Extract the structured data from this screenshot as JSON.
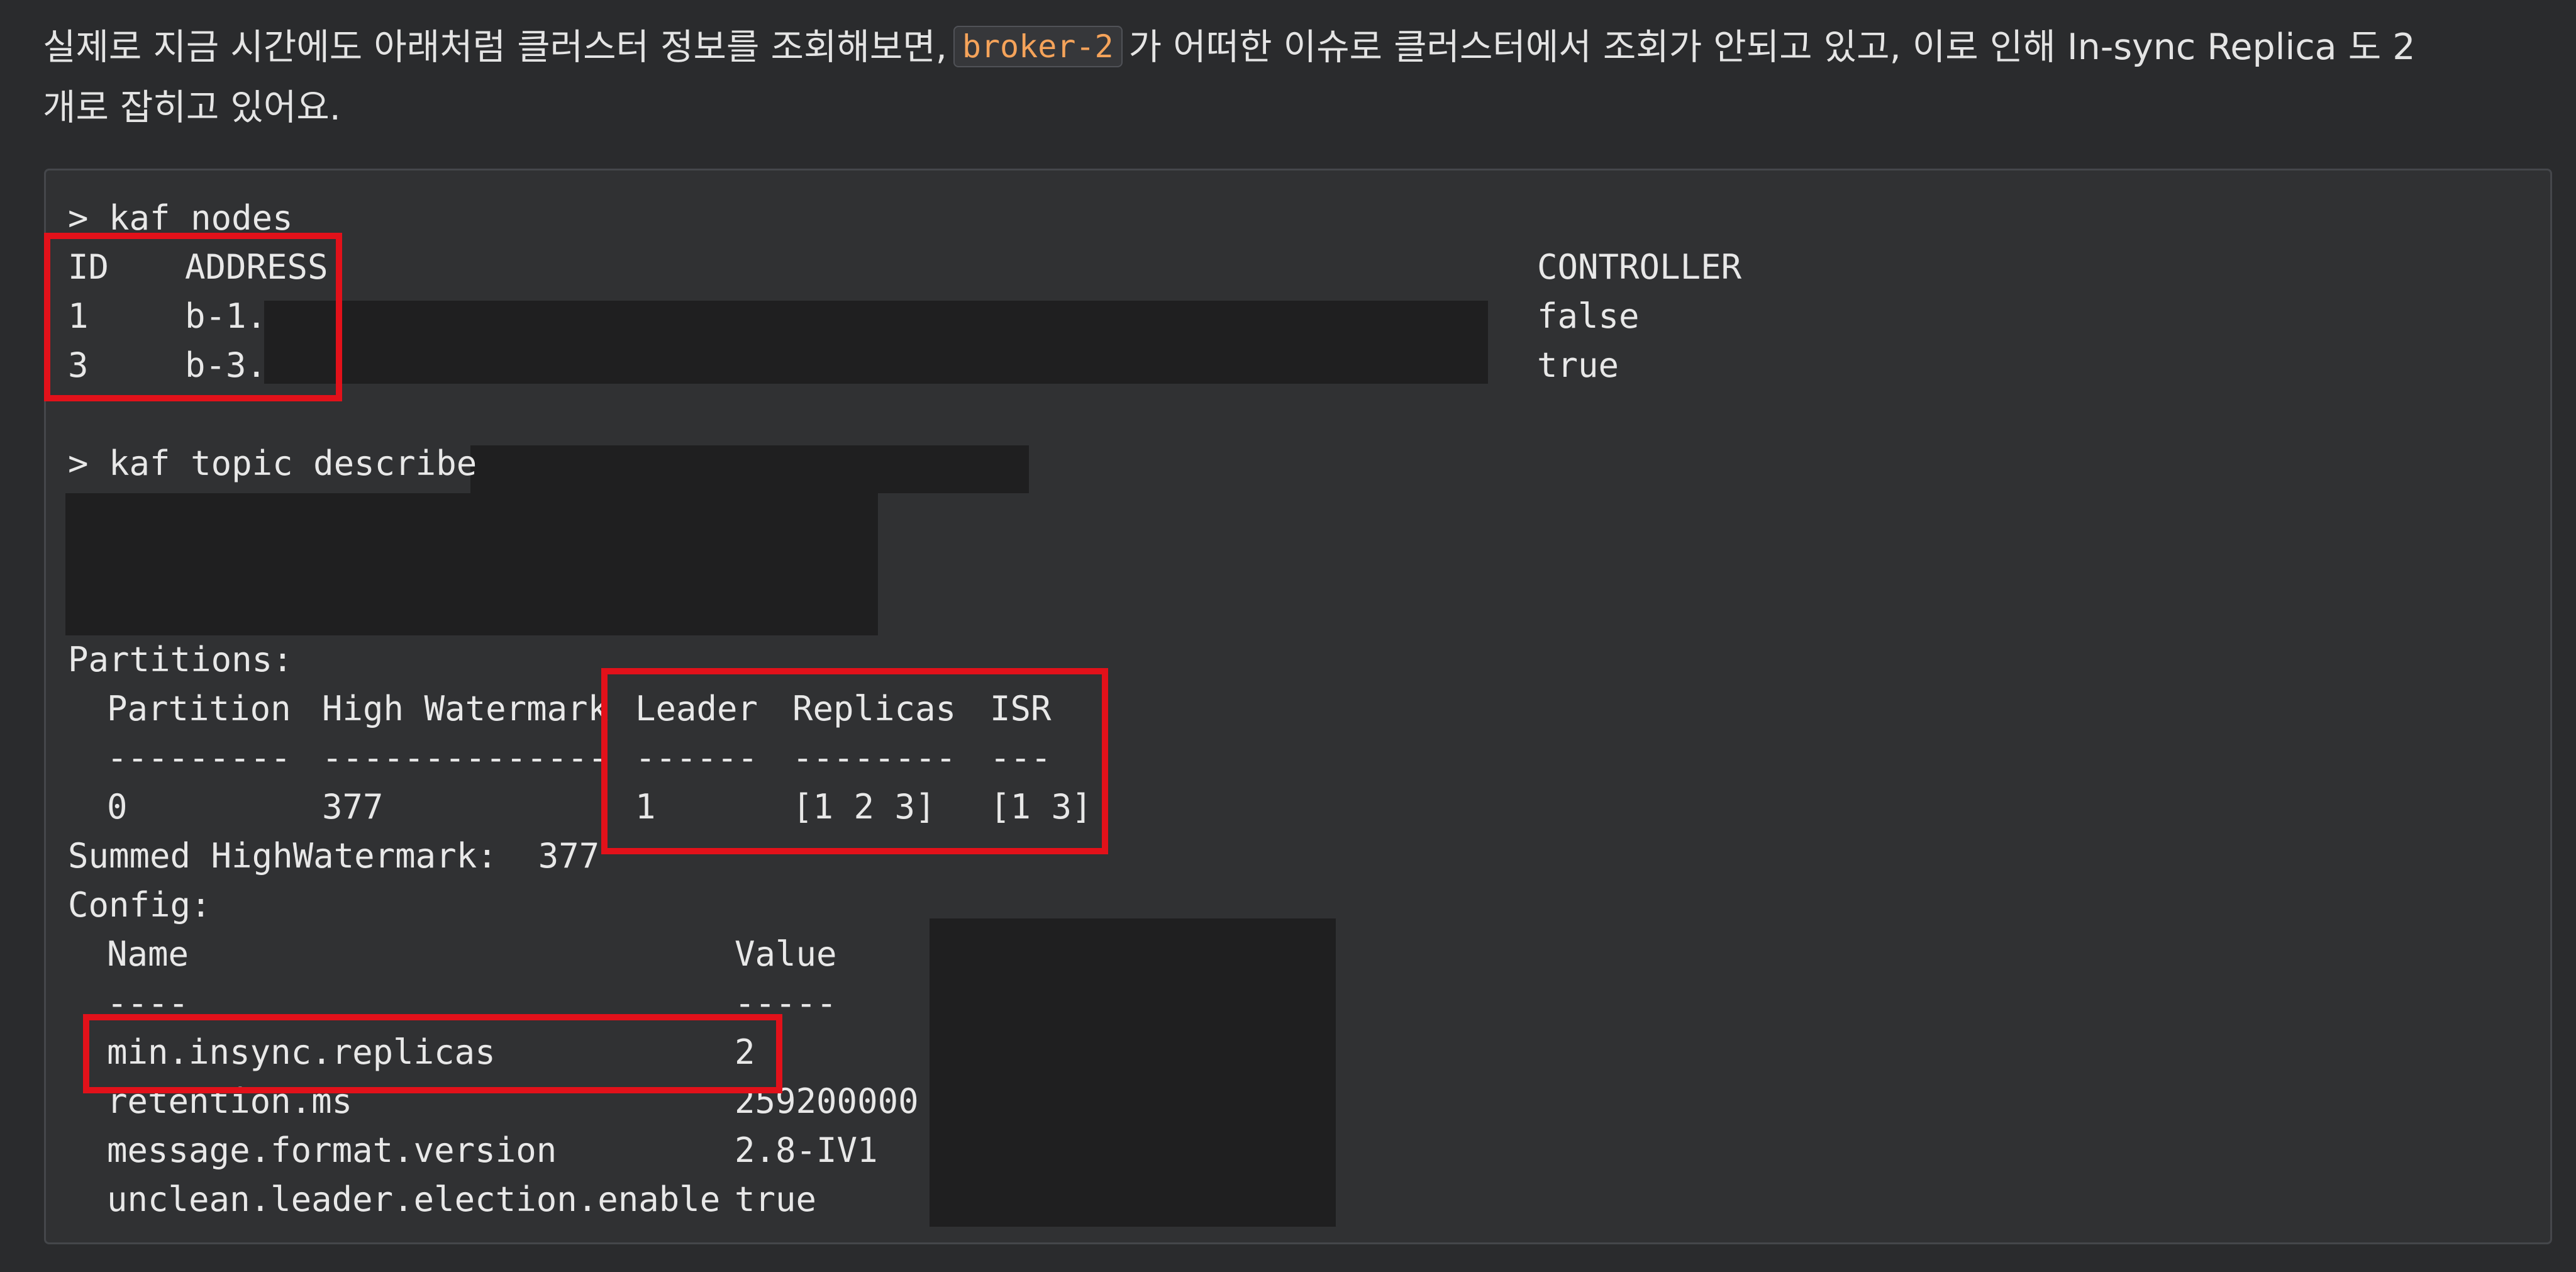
{
  "intro": {
    "before": "실제로 지금 시간에도 아래처럼 클러스터 정보를 조회해보면,",
    "broker": "broker-2",
    "after": "가 어떠한 이슈로 클러스터에서 조회가 안되고 있고, 이로 인해 In-sync Replica 도 2",
    "line2": "개로 잡히고 있어요."
  },
  "terminal": {
    "cmd_nodes": "> kaf nodes",
    "nodes_headers": {
      "id": "ID",
      "address": "ADDRESS",
      "controller": "CONTROLLER"
    },
    "nodes": [
      {
        "id": "1",
        "address": "b-1.",
        "controller": "false"
      },
      {
        "id": "3",
        "address": "b-3.",
        "controller": "true"
      }
    ],
    "cmd_describe": "> kaf topic describe",
    "partitions_label": "Partitions:",
    "partition_headers": {
      "partition": "Partition",
      "high_watermark": "High Watermark",
      "leader": "Leader",
      "replicas": "Replicas",
      "isr": "ISR"
    },
    "partition_dashes": {
      "partition": "---------",
      "high_watermark": "--------------",
      "leader": "------",
      "replicas": "--------",
      "isr": "---"
    },
    "partitions": [
      {
        "partition": "0",
        "high_watermark": "377",
        "leader": "1",
        "replicas": "[1 2 3]",
        "isr": "[1 3]"
      }
    ],
    "summed": "Summed HighWatermark:  377",
    "config_label": "Config:",
    "config_headers": {
      "name": "Name",
      "value": "Value"
    },
    "config_dashes": {
      "name": "----",
      "value": "-----"
    },
    "config": [
      {
        "name": "min.insync.replicas",
        "value": "2"
      },
      {
        "name": "retention.ms",
        "value": "259200000"
      },
      {
        "name": "message.format.version",
        "value": "2.8-IV1"
      },
      {
        "name": "unclean.leader.election.enable",
        "value": "true"
      }
    ]
  },
  "colors": {
    "highlight": "#e2111a",
    "inline_code": "#f5a35a",
    "redaction": "#1f1f20"
  }
}
